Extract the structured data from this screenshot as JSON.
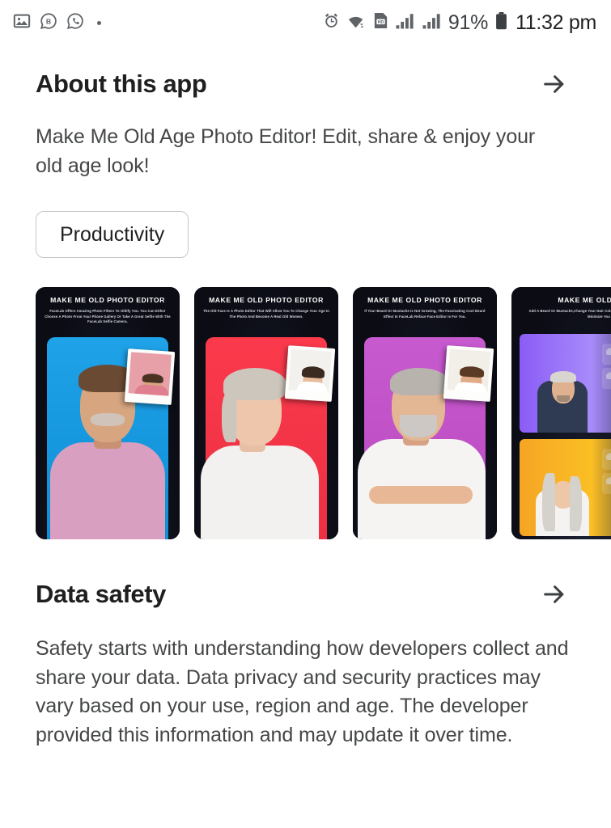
{
  "status_bar": {
    "left_icons": [
      {
        "name": "image-icon",
        "glyph": "image"
      },
      {
        "name": "whatsapp-business-icon",
        "glyph": "B"
      },
      {
        "name": "whatsapp-icon",
        "glyph": "phone"
      },
      {
        "name": "notification-dot",
        "glyph": "dot"
      }
    ],
    "right_icons": [
      {
        "name": "alarm-icon"
      },
      {
        "name": "wifi-icon"
      },
      {
        "name": "hd-sim-icon"
      },
      {
        "name": "signal-bars-sim1-icon"
      },
      {
        "name": "signal-bars-sim2-icon"
      }
    ],
    "battery_percent": "91%",
    "time": "11:32 pm"
  },
  "about": {
    "title": "About this app",
    "arrow_label": "→",
    "description": "Make Me Old Age Photo Editor! Edit, share & enjoy your old age look!",
    "category_chip": "Productivity"
  },
  "screenshots": [
    {
      "name": "screenshot-1",
      "title": "MAKE ME OLD PHOTO EDITOR",
      "subtitle": "FaceLab Offers Amazing Photo Filters To Oldify You. You Can Either Choose A Photo From Your Phone Gallery Or Take A Great Selfie With The FaceLab Selfie Camera.",
      "accent_color": "#1fa2e8",
      "shirt_color": "#d99fc0",
      "hair_color": "#6b4a33"
    },
    {
      "name": "screenshot-2",
      "title": "MAKE ME OLD PHOTO EDITOR",
      "subtitle": "The Old Face Is A Photo Editor That Will Allow You To Change Your Age In The Photo And Become A Real Old Women.",
      "accent_color": "#fb3a4c",
      "shirt_color": "#f2f1ef",
      "hair_color": "#cdc6bd"
    },
    {
      "name": "screenshot-3",
      "title": "MAKE ME OLD PHOTO EDITOR",
      "subtitle": "If Your Beard Or Mustache Is Not Growing, The Fascinating Cool Beard Effect In FaceLab Reface Face Editor Is For You.",
      "accent_color": "#c85ad0",
      "shirt_color": "#f5f4f2",
      "hair_color": "#b9b3ad"
    },
    {
      "name": "screenshot-4",
      "title": "MAKE ME OLD PHOTO",
      "subtitle": "Add A Beard Or Mustache,Change Your Hair Color And Hairstyle,Easily Enlarge Or Minimize You",
      "accent_color": "#8b5cf6",
      "shirt_color": "#2f3b52",
      "hair_color": "#d8d4cf"
    }
  ],
  "data_safety": {
    "title": "Data safety",
    "arrow_label": "→",
    "description": "Safety starts with understanding how developers collect and share your data. Data privacy and security practices may vary based on your use, region and age. The developer provided this information and may update it over time."
  },
  "colors": {
    "background": "#ffffff",
    "heading": "#1f1f1f",
    "body": "#444746",
    "chip_border": "#c4c7c5",
    "status_icon": "#5f6368"
  }
}
